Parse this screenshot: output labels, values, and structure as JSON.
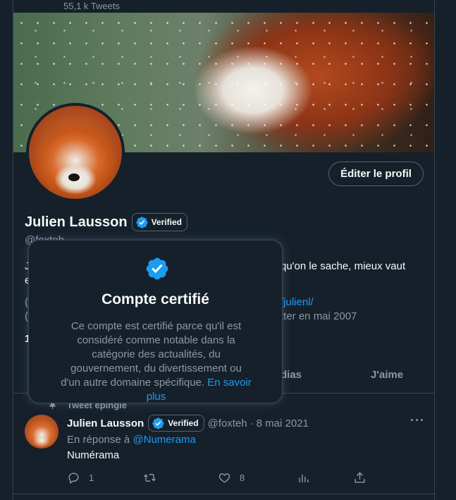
{
  "header": {
    "tweet_count": "55,1 k Tweets"
  },
  "profile": {
    "edit_button": "Éditer le profil",
    "display_name": "Julien Lausson",
    "verified_label": "Verified",
    "handle": "@foxteh",
    "bio_visible_left_1": "J",
    "bio_visible_left_2": "e",
    "bio_visible_right": "qu'on le sache, mieux vaut",
    "link_visible": "/julienl/",
    "joined_visible": "tter en mai 2007",
    "meta_left_1": "(",
    "meta_left_2": "(",
    "follow_left": "1"
  },
  "tabs": {
    "medias": "dias",
    "likes": "J'aime"
  },
  "popover": {
    "title": "Compte certifié",
    "body": "Ce compte est certifié parce qu'il est considéré comme notable dans la catégorie des actualités, du gouvernement, du divertissement ou d'un autre domaine spécifique.",
    "learn_more": "En savoir plus"
  },
  "pinned_tweet": {
    "pinned_label": "Tweet épinglé",
    "author_name": "Julien Lausson",
    "verified_label": "Verified",
    "author_handle": "@foxteh",
    "separator": "·",
    "date": "8 mai 2021",
    "more": "···",
    "reply_prefix": "En réponse à",
    "reply_mention": "@Numerama",
    "text": "Numérama",
    "reply_count": "1",
    "like_count": "8"
  },
  "colors": {
    "background": "#15202b",
    "accent": "#1d9bf0",
    "muted": "#8b98a5",
    "border": "#38444d"
  },
  "icons": [
    "verified-badge-icon",
    "pin-icon",
    "reply-icon",
    "retweet-icon",
    "like-icon",
    "analytics-icon",
    "share-icon",
    "more-icon"
  ]
}
